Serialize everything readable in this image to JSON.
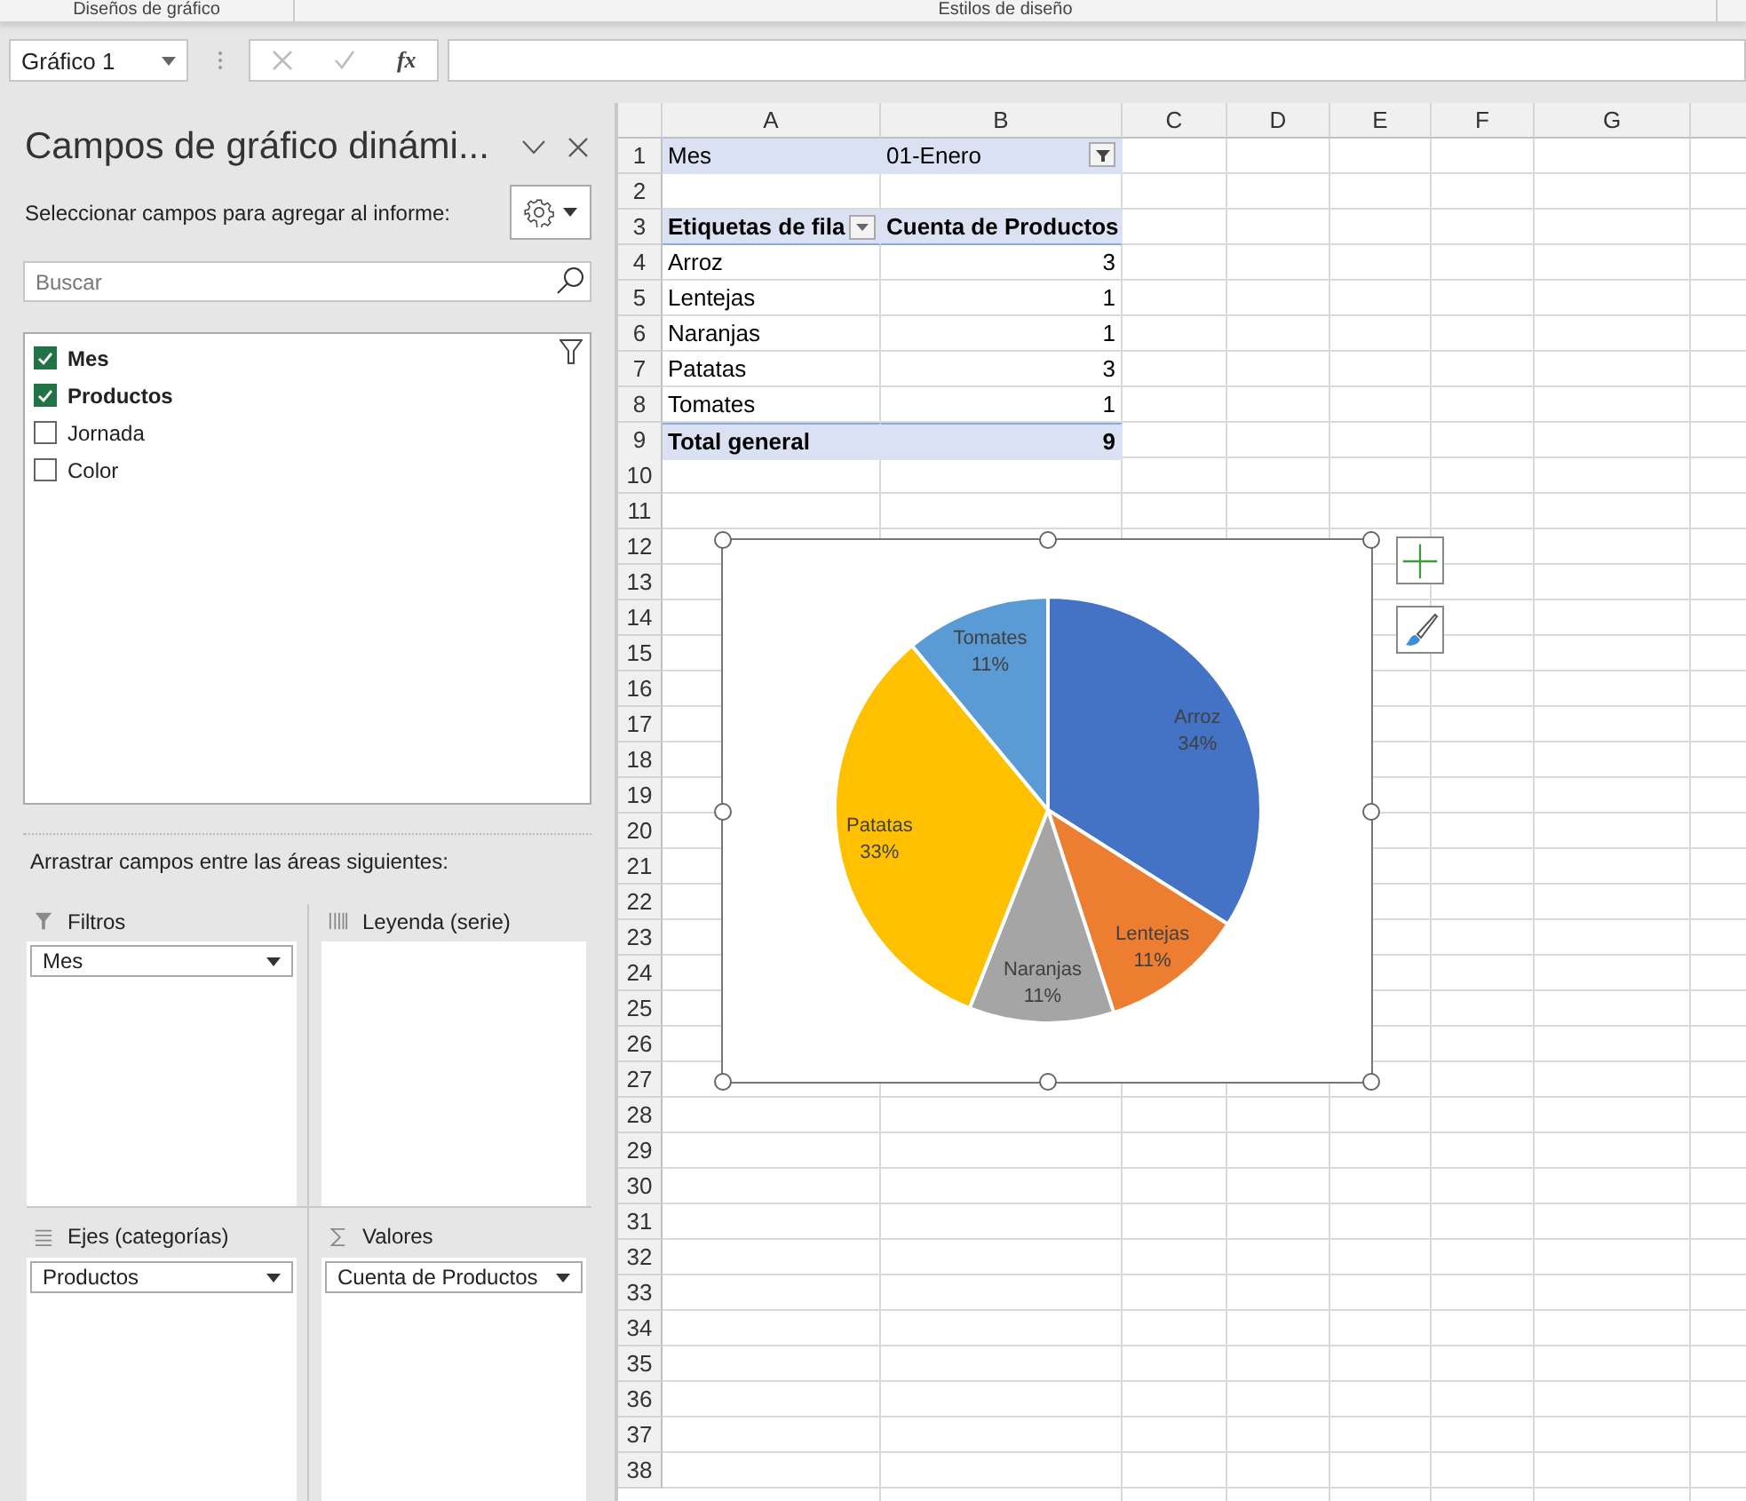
{
  "ribbon": {
    "groups": [
      "Diseños de gráfico",
      "Estilos de diseño"
    ]
  },
  "formula_bar": {
    "name_box": "Gráfico 1",
    "function_label": "fx"
  },
  "pane": {
    "title": "Campos de gráfico dinámi...",
    "subtitle": "Seleccionar campos para agregar al informe:",
    "search": {
      "placeholder": "Buscar"
    },
    "fields": [
      {
        "name": "Mes",
        "checked": true
      },
      {
        "name": "Productos",
        "checked": true
      },
      {
        "name": "Jornada",
        "checked": false
      },
      {
        "name": "Color",
        "checked": false
      }
    ],
    "areas_label": "Arrastrar campos entre las áreas siguientes:",
    "areas": [
      {
        "kind": "filter",
        "title": "Filtros",
        "items": [
          "Mes"
        ]
      },
      {
        "kind": "legend",
        "title": "Leyenda (serie)"
      },
      {
        "kind": "axis",
        "title": "Ejes (categorías)",
        "items": [
          "Productos"
        ]
      },
      {
        "kind": "values",
        "title": "Valores",
        "items": [
          "Cuenta de Productos"
        ]
      }
    ]
  },
  "sheet": {
    "columns": [
      "A",
      "B",
      "C",
      "D",
      "E",
      "F",
      "G"
    ],
    "rows": [
      {
        "number": "1",
        "kind": "filter",
        "label": "Mes",
        "value": "01-Enero"
      },
      {
        "number": "2",
        "kind": "blank"
      },
      {
        "number": "3",
        "kind": "header",
        "label": "Etiquetas de fila",
        "value": "Cuenta de Productos"
      },
      {
        "number": "4",
        "kind": "item",
        "label": "Arroz",
        "value": "3"
      },
      {
        "number": "5",
        "kind": "item",
        "label": "Lentejas",
        "value": "1"
      },
      {
        "number": "6",
        "kind": "item",
        "label": "Naranjas",
        "value": "1"
      },
      {
        "number": "7",
        "kind": "item",
        "label": "Patatas",
        "value": "3"
      },
      {
        "number": "8",
        "kind": "item",
        "label": "Tomates",
        "value": "1"
      },
      {
        "number": "9",
        "kind": "total",
        "label": "Total general",
        "value": "9"
      },
      {
        "number": "10",
        "kind": "blank"
      },
      {
        "number": "11",
        "kind": "blank"
      },
      {
        "number": "12",
        "kind": "blank"
      },
      {
        "number": "13",
        "kind": "blank"
      },
      {
        "number": "14",
        "kind": "blank"
      },
      {
        "number": "15",
        "kind": "blank"
      },
      {
        "number": "16",
        "kind": "blank"
      },
      {
        "number": "17",
        "kind": "blank"
      },
      {
        "number": "18",
        "kind": "blank"
      },
      {
        "number": "19",
        "kind": "blank"
      },
      {
        "number": "20",
        "kind": "blank"
      },
      {
        "number": "21",
        "kind": "blank"
      },
      {
        "number": "22",
        "kind": "blank"
      },
      {
        "number": "23",
        "kind": "blank"
      },
      {
        "number": "24",
        "kind": "blank"
      },
      {
        "number": "25",
        "kind": "blank"
      },
      {
        "number": "26",
        "kind": "blank"
      },
      {
        "number": "27",
        "kind": "blank"
      },
      {
        "number": "28",
        "kind": "blank"
      },
      {
        "number": "29",
        "kind": "blank"
      },
      {
        "number": "30",
        "kind": "blank"
      },
      {
        "number": "31",
        "kind": "blank"
      },
      {
        "number": "32",
        "kind": "blank"
      },
      {
        "number": "33",
        "kind": "blank"
      },
      {
        "number": "34",
        "kind": "blank"
      },
      {
        "number": "35",
        "kind": "blank"
      },
      {
        "number": "36",
        "kind": "blank"
      },
      {
        "number": "37",
        "kind": "blank"
      },
      {
        "number": "38",
        "kind": "blank"
      }
    ],
    "chart": {
      "chart_data": {
        "type": "pie",
        "categories": [
          "Arroz",
          "Lentejas",
          "Naranjas",
          "Patatas",
          "Tomates"
        ],
        "values": [
          34,
          11,
          11,
          33,
          11
        ],
        "colors": [
          "#4472c4",
          "#ed7d31",
          "#a5a5a5",
          "#ffc000",
          "#5b9bd5"
        ],
        "data_labels": true,
        "value_labels": [
          "34%",
          "11%",
          "11%",
          "33%",
          "11%"
        ]
      }
    }
  }
}
